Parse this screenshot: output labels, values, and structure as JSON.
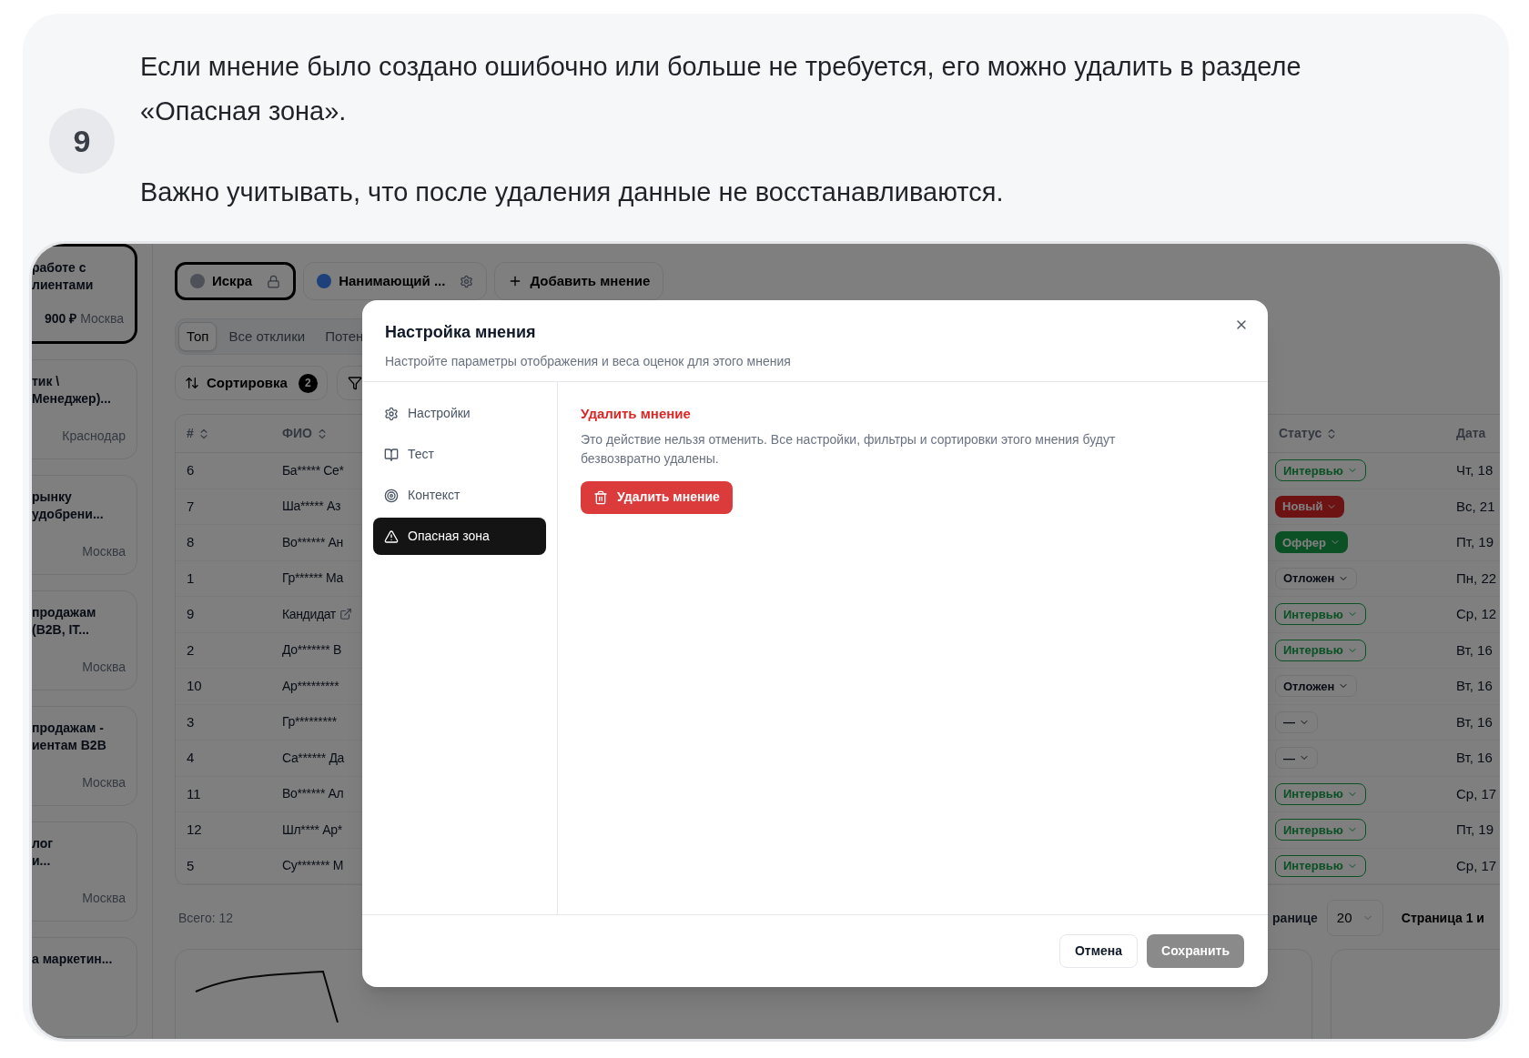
{
  "step": {
    "number": "9",
    "paragraphs": [
      "Если мнение было создано ошибочно или больше не требуется, его можно удалить в разделе «Опасная зона».",
      "Важно учитывать, что после удаления данные не восстанавливаются."
    ]
  },
  "sidebar": {
    "cards": [
      {
        "lines": [
          "работе с",
          "лиентами"
        ],
        "salary": "900 ₽",
        "city": "Москва",
        "selected": true
      },
      {
        "lines": [
          "тик \\",
          "Менеджер)..."
        ],
        "city": "Краснодар",
        "selected": false
      },
      {
        "lines": [
          "рынку",
          "удобрени..."
        ],
        "city": "Москва",
        "selected": false
      },
      {
        "lines": [
          "продажам",
          "(B2B, IT..."
        ],
        "city": "Москва",
        "selected": false
      },
      {
        "lines": [
          "продажам -",
          "иентам B2B"
        ],
        "city": "Москва",
        "selected": false
      },
      {
        "lines": [
          "лог",
          "и..."
        ],
        "city": "Москва",
        "selected": false
      },
      {
        "lines": [
          "а маркетин..."
        ],
        "selected": false
      }
    ]
  },
  "opinion_tabs": [
    {
      "label": "Искра",
      "color": "#4e5258",
      "selected": true
    },
    {
      "label": "Нанимающий ...",
      "color": "#1e417b",
      "selected": false
    }
  ],
  "add_opinion": "Добавить мнение",
  "view_tabs": [
    {
      "label": "Топ",
      "selected": true
    },
    {
      "label": "Все отклики",
      "selected": false
    },
    {
      "label": "Потен",
      "selected": false
    }
  ],
  "sort_button": {
    "label": "Сортировка",
    "count": "2"
  },
  "table": {
    "columns": [
      "#",
      "ФИО",
      "Статус",
      "Дата"
    ],
    "rows": [
      {
        "num": "6",
        "name": "Ба***** Се*",
        "link": false,
        "status": {
          "label": "Интервью",
          "kind": "interview"
        },
        "date": "Чт, 18"
      },
      {
        "num": "7",
        "name": "Ша***** Аз",
        "link": false,
        "status": {
          "label": "Новый",
          "kind": "new"
        },
        "date": "Вс, 21"
      },
      {
        "num": "8",
        "name": "Во****** Ан",
        "link": false,
        "status": {
          "label": "Оффер",
          "kind": "offer"
        },
        "date": "Пт, 19"
      },
      {
        "num": "1",
        "name": "Гр****** Ма",
        "link": false,
        "status": {
          "label": "Отложен",
          "kind": "neutral"
        },
        "date": "Пн, 22"
      },
      {
        "num": "9",
        "name": "Кандидат",
        "link": true,
        "status": {
          "label": "Интервью",
          "kind": "interview"
        },
        "date": "Ср, 12"
      },
      {
        "num": "2",
        "name": "До******* В",
        "link": false,
        "status": {
          "label": "Интервью",
          "kind": "interview"
        },
        "date": "Вт, 16"
      },
      {
        "num": "10",
        "name": "Ар*********",
        "link": false,
        "status": {
          "label": "Отложен",
          "kind": "neutral"
        },
        "date": "Вт, 16"
      },
      {
        "num": "3",
        "name": "Гр*********",
        "link": false,
        "status": {
          "label": "—",
          "kind": "neutral"
        },
        "date": "Вт, 16"
      },
      {
        "num": "4",
        "name": "Са****** Да",
        "link": false,
        "status": {
          "label": "—",
          "kind": "neutral"
        },
        "date": "Вт, 16"
      },
      {
        "num": "11",
        "name": "Во****** Ал",
        "link": false,
        "status": {
          "label": "Интервью",
          "kind": "interview"
        },
        "date": "Ср, 17"
      },
      {
        "num": "12",
        "name": "Шл**** Ар*",
        "link": false,
        "status": {
          "label": "Интервью",
          "kind": "interview"
        },
        "date": "Пт, 19"
      },
      {
        "num": "5",
        "name": "Су******* М",
        "link": false,
        "status": {
          "label": "Интервью",
          "kind": "interview"
        },
        "date": "Ср, 17"
      }
    ]
  },
  "footer": {
    "total": "Всего: 12",
    "per_page_label": "ранице",
    "per_page": "20",
    "page": "Страница 1 и"
  },
  "modal": {
    "title": "Настройка мнения",
    "subtitle": "Настройте параметры отображения и веса оценок для этого мнения",
    "nav": [
      {
        "label": "Настройки",
        "selected": false
      },
      {
        "label": "Тест",
        "selected": false
      },
      {
        "label": "Контекст",
        "selected": false
      },
      {
        "label": "Опасная зона",
        "selected": true
      }
    ],
    "section_title": "Удалить мнение",
    "description": "Это действие нельзя отменить. Все настройки, фильтры и сортировки этого мнения будут безвозвратно удалены.",
    "delete_button": "Удалить мнение",
    "cancel_button": "Отмена",
    "save_button": {
      "label": "Сохранить",
      "disabled": true
    }
  }
}
